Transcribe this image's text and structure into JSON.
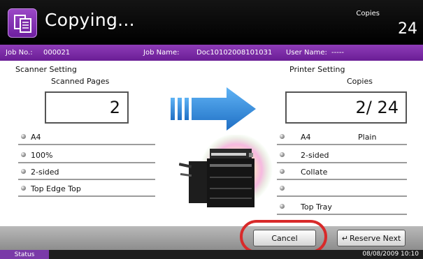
{
  "header": {
    "title": "Copying...",
    "copies_label": "Copies",
    "copies_value": "24",
    "accent_color": "#7b2aa8"
  },
  "job": {
    "no_label": "Job No.:",
    "no_value": "000021",
    "name_label": "Job Name:",
    "name_value": "Doc10102008101031",
    "user_label": "User Name:",
    "user_value": "-----"
  },
  "scanner": {
    "title": "Scanner Setting",
    "pages_label": "Scanned Pages",
    "pages_value": "2",
    "options": [
      "A4",
      "100%",
      "2-sided",
      "Top Edge Top"
    ]
  },
  "printer": {
    "title": "Printer Setting",
    "copies_label": "Copies",
    "copies_value": "2/   24",
    "options": [
      {
        "left": "A4",
        "right": "Plain"
      },
      {
        "left": "2-sided",
        "right": ""
      },
      {
        "left": "Collate",
        "right": ""
      },
      {
        "left": "",
        "right": ""
      },
      {
        "left": "Top Tray",
        "right": ""
      }
    ]
  },
  "buttons": {
    "cancel": "Cancel",
    "reserve_next": "Reserve Next"
  },
  "status": {
    "label": "Status",
    "datetime": "08/08/2009   10:10"
  }
}
